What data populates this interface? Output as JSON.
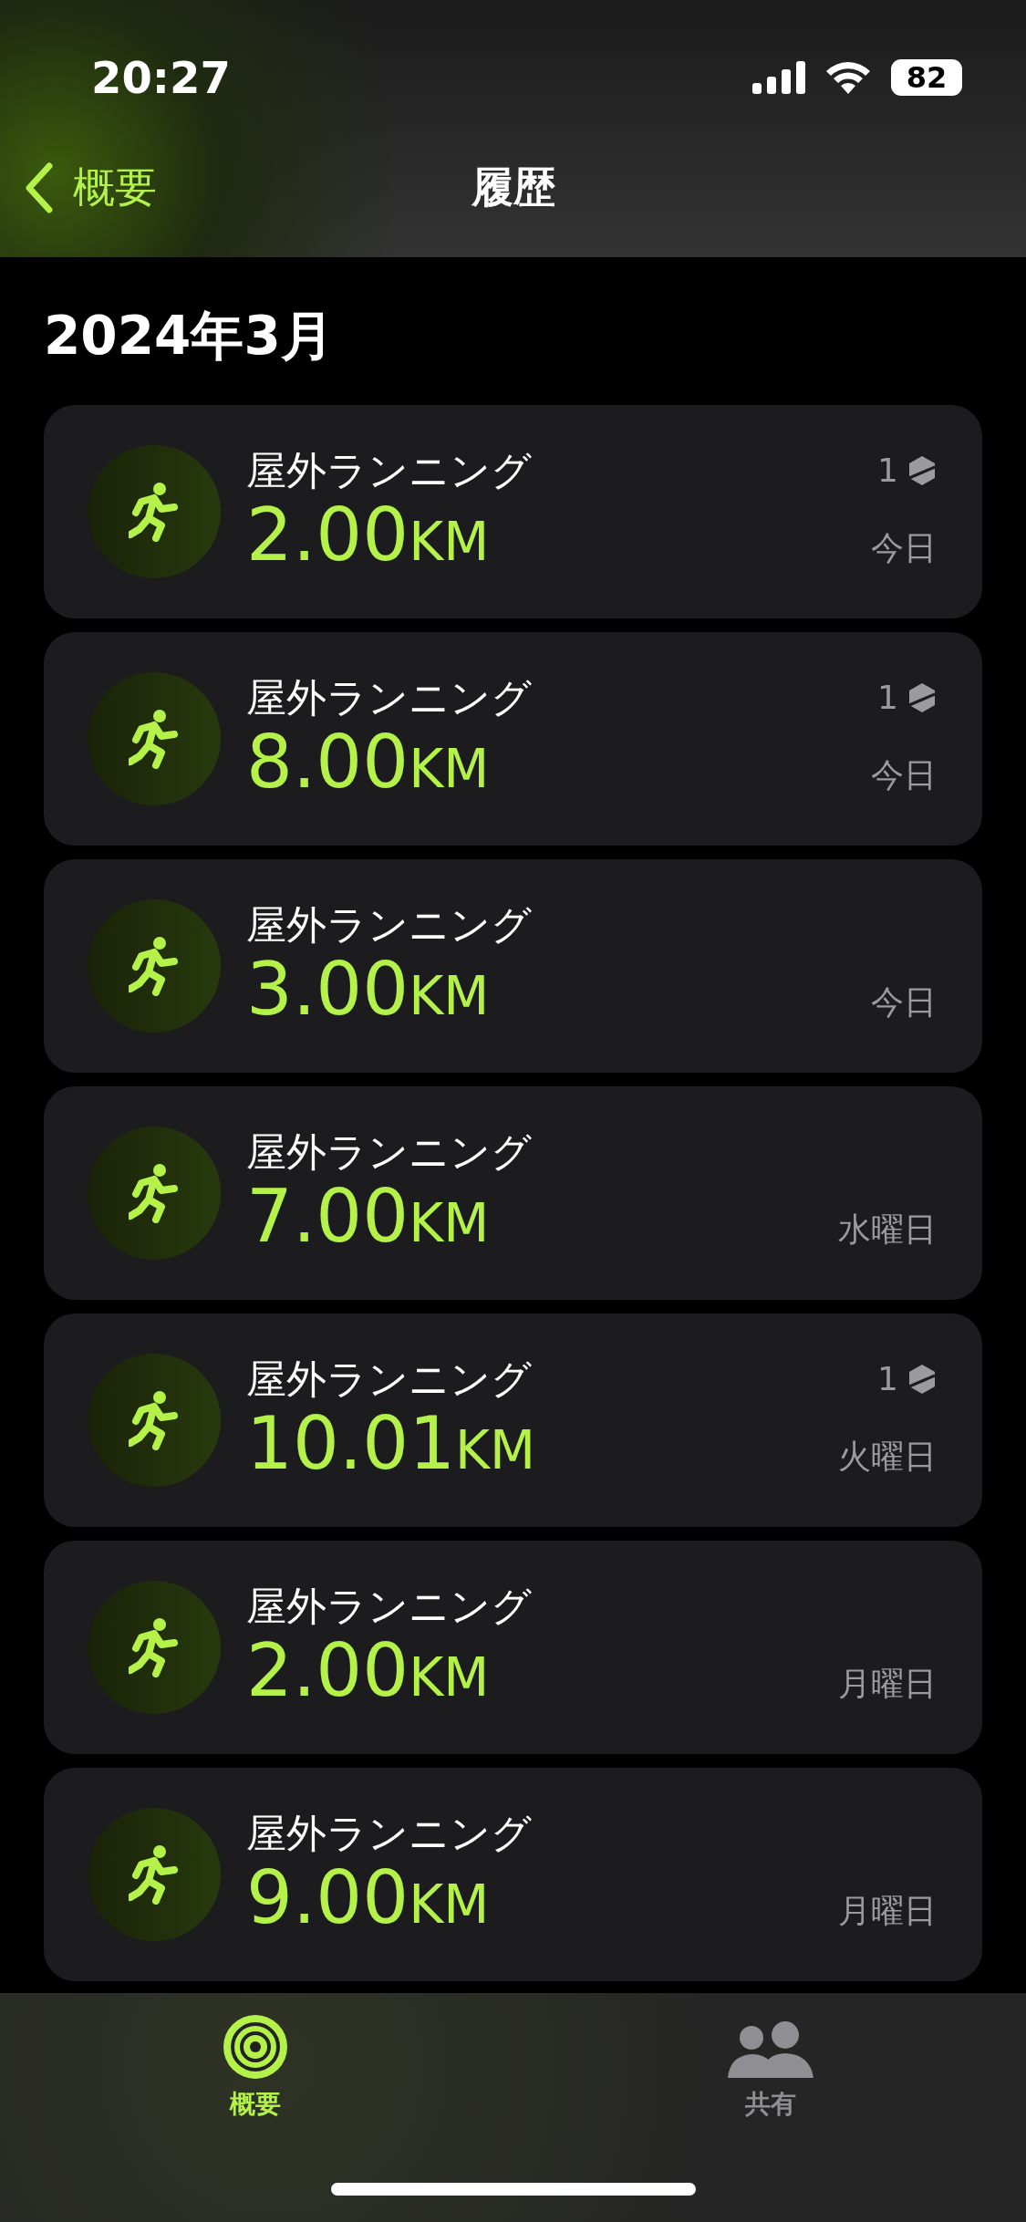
{
  "status_bar": {
    "time": "20:27",
    "battery": "82"
  },
  "nav_bar": {
    "back_label": "概要",
    "title": "履歴"
  },
  "section_title": "2024年3月",
  "workouts": [
    {
      "name": "屋外ランニング",
      "distance": "2.00",
      "unit": "KM",
      "badge_count": "1",
      "day": "今日"
    },
    {
      "name": "屋外ランニング",
      "distance": "8.00",
      "unit": "KM",
      "badge_count": "1",
      "day": "今日"
    },
    {
      "name": "屋外ランニング",
      "distance": "3.00",
      "unit": "KM",
      "day": "今日"
    },
    {
      "name": "屋外ランニング",
      "distance": "7.00",
      "unit": "KM",
      "day": "水曜日"
    },
    {
      "name": "屋外ランニング",
      "distance": "10.01",
      "unit": "KM",
      "badge_count": "1",
      "day": "火曜日"
    },
    {
      "name": "屋外ランニング",
      "distance": "2.00",
      "unit": "KM",
      "day": "月曜日"
    },
    {
      "name": "屋外ランニング",
      "distance": "9.00",
      "unit": "KM",
      "day": "月曜日"
    }
  ],
  "tab_bar": [
    {
      "label": "概要",
      "kind": "rings",
      "selected": true
    },
    {
      "label": "共有",
      "kind": "people",
      "selected": false
    }
  ]
}
